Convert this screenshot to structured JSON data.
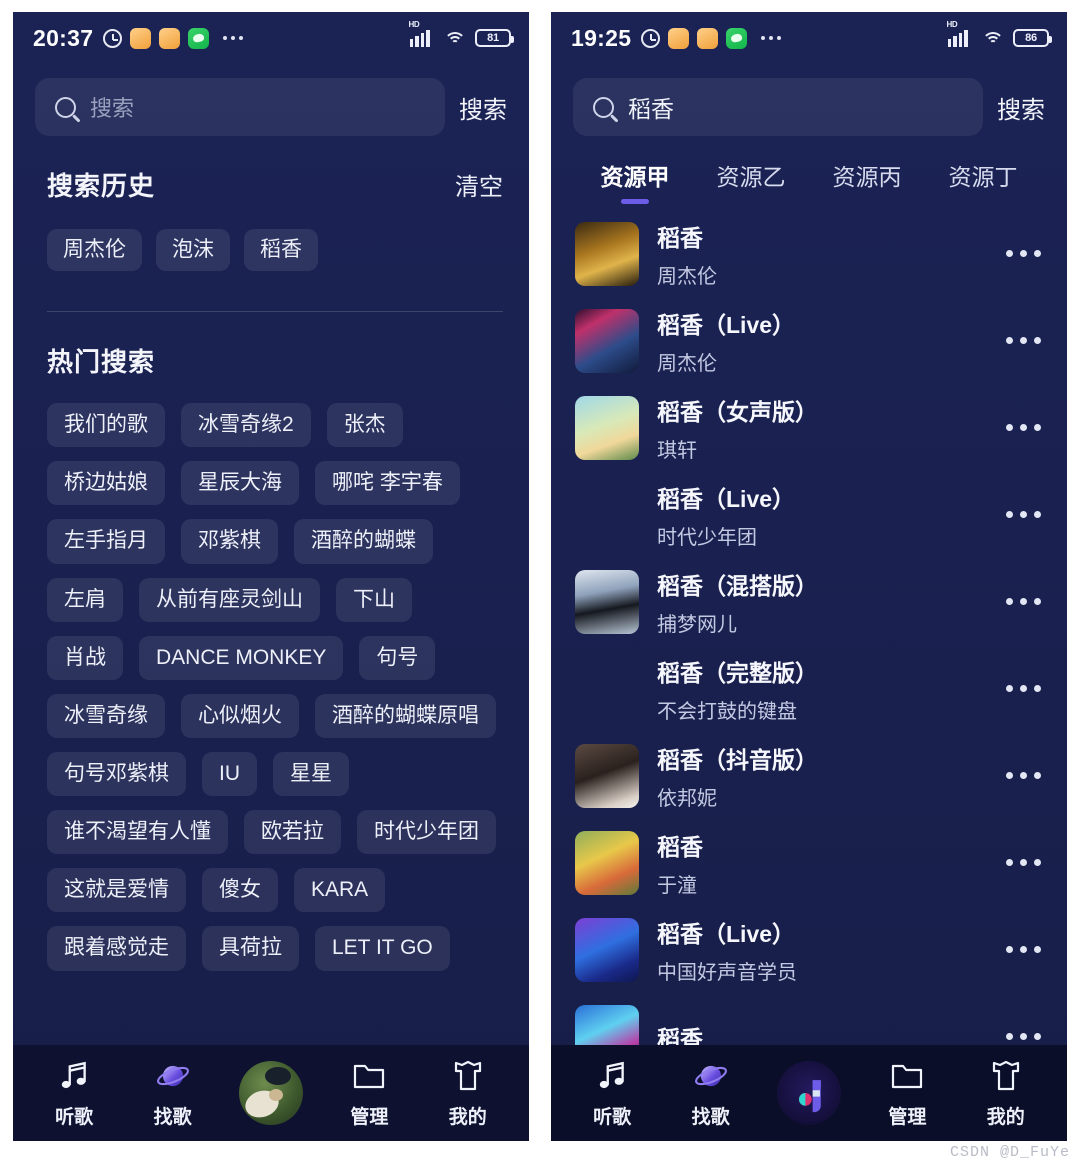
{
  "watermark": "CSDN @D_FuYe",
  "left": {
    "statusbar": {
      "time": "20:37",
      "battery": "81",
      "network_label": "HD",
      "icons": [
        "alarm-clock-icon",
        "app-orange-icon",
        "app-orange-icon",
        "wechat-icon",
        "overflow-dots-icon"
      ]
    },
    "search": {
      "placeholder": "搜索",
      "value": "",
      "button_label": "搜索",
      "icon": "search-icon"
    },
    "history": {
      "title": "搜索历史",
      "action_label": "清空",
      "items": [
        "周杰伦",
        "泡沫",
        "稻香"
      ]
    },
    "hot": {
      "title": "热门搜索",
      "items": [
        "我们的歌",
        "冰雪奇缘2",
        "张杰",
        "桥边姑娘",
        "星辰大海",
        "哪咤 李宇春",
        "左手指月",
        "邓紫棋",
        "酒醉的蝴蝶",
        "左肩",
        "从前有座灵剑山",
        "下山",
        "肖战",
        "DANCE MONKEY",
        "句号",
        "冰雪奇缘",
        "心似烟火",
        "酒醉的蝴蝶原唱",
        "句号邓紫棋",
        "IU",
        "星星",
        "谁不渴望有人懂",
        "欧若拉",
        "时代少年团",
        "这就是爱情",
        "傻女",
        "KARA",
        "跟着感觉走",
        "具荷拉",
        "LET IT GO"
      ]
    },
    "nav": [
      {
        "label": "听歌",
        "icon": "music-note-icon"
      },
      {
        "label": "找歌",
        "icon": "planet-icon"
      },
      {
        "label": "",
        "icon": "user-avatar-icon"
      },
      {
        "label": "管理",
        "icon": "folder-icon"
      },
      {
        "label": "我的",
        "icon": "shirt-icon"
      }
    ]
  },
  "right": {
    "statusbar": {
      "time": "19:25",
      "battery": "86",
      "network_label": "HD",
      "icons": [
        "alarm-clock-icon",
        "app-orange-icon",
        "app-orange-icon",
        "wechat-icon",
        "overflow-dots-icon"
      ]
    },
    "search": {
      "placeholder": "搜索",
      "value": "稻香",
      "button_label": "搜索",
      "icon": "search-icon"
    },
    "tabs": [
      {
        "label": "资源甲",
        "active": true
      },
      {
        "label": "资源乙",
        "active": false
      },
      {
        "label": "资源丙",
        "active": false
      },
      {
        "label": "资源丁",
        "active": false
      }
    ],
    "songs": [
      {
        "title": "稻香",
        "artist": "周杰伦",
        "has_thumb": true,
        "thumb": "album-sunset"
      },
      {
        "title": "稻香（Live）",
        "artist": "周杰伦",
        "has_thumb": true,
        "thumb": "album-concert"
      },
      {
        "title": "稻香（女声版）",
        "artist": "琪轩",
        "has_thumb": true,
        "thumb": "album-anime"
      },
      {
        "title": "稻香（Live）",
        "artist": "时代少年团",
        "has_thumb": false,
        "thumb": ""
      },
      {
        "title": "稻香（混搭版）",
        "artist": "捕梦网儿",
        "has_thumb": true,
        "thumb": "album-tree"
      },
      {
        "title": "稻香（完整版）",
        "artist": "不会打鼓的键盘",
        "has_thumb": false,
        "thumb": ""
      },
      {
        "title": "稻香（抖音版）",
        "artist": "依邦妮",
        "has_thumb": true,
        "thumb": "album-girl"
      },
      {
        "title": "稻香",
        "artist": "于潼",
        "has_thumb": true,
        "thumb": "album-pooh"
      },
      {
        "title": "稻香（Live）",
        "artist": "中国好声音学员",
        "has_thumb": true,
        "thumb": "album-voice"
      },
      {
        "title": "稻香",
        "artist": "",
        "has_thumb": true,
        "thumb": "album-blue"
      }
    ],
    "nav": [
      {
        "label": "听歌",
        "icon": "music-note-icon"
      },
      {
        "label": "找歌",
        "icon": "planet-icon"
      },
      {
        "label": "",
        "icon": "app-logo-icon"
      },
      {
        "label": "管理",
        "icon": "folder-icon"
      },
      {
        "label": "我的",
        "icon": "shirt-icon"
      }
    ]
  },
  "colors": {
    "panel_bg": "#1a2252",
    "nav_bg": "#0e1130",
    "accent": "#6c5ce7",
    "text_primary": "#f4f5fb",
    "text_secondary": "#c3c9e2"
  }
}
